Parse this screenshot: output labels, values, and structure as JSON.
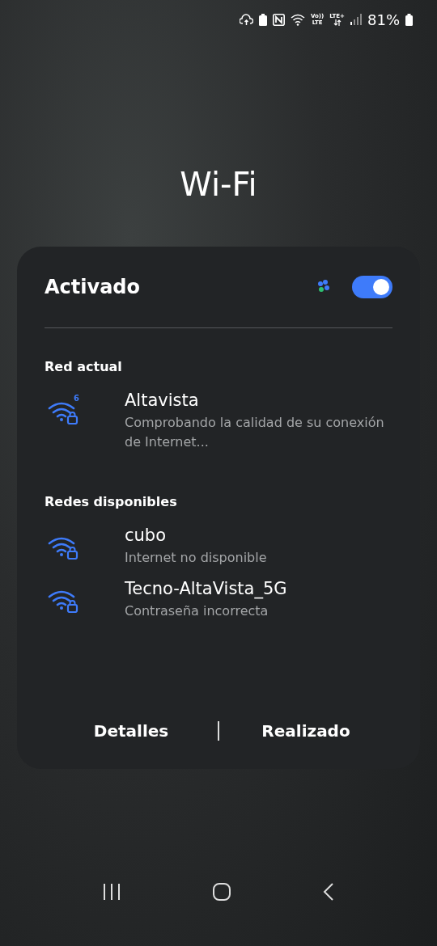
{
  "status_bar": {
    "volte": [
      "Vo))",
      "LTE"
    ],
    "lte": "LTE+",
    "battery": "81%"
  },
  "title": "Wi-Fi",
  "card": {
    "label": "Activado",
    "on": true,
    "sections": [
      {
        "heading": "Red actual",
        "networks": [
          {
            "name": "Altavista",
            "status": "Comprobando la calidad de su conexión de Internet...",
            "badge": "6"
          }
        ]
      },
      {
        "heading": "Redes disponibles",
        "networks": [
          {
            "name": "cubo",
            "status": "Internet no disponible"
          },
          {
            "name": "Tecno-AltaVista_5G",
            "status": "Contraseña incorrecta"
          }
        ]
      }
    ],
    "buttons": [
      "Detalles",
      "Realizado"
    ]
  }
}
